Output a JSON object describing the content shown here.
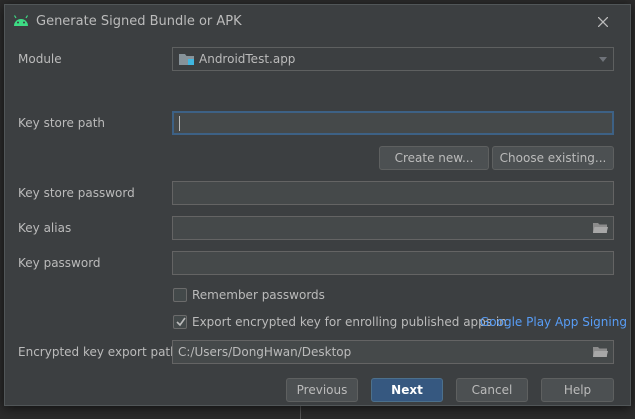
{
  "dialog": {
    "title": "Generate Signed Bundle or APK",
    "title_icon": "android-icon",
    "close_icon": "close-icon"
  },
  "module": {
    "label": "Module",
    "value": "AndroidTest.app"
  },
  "key_store": {
    "path_label": "Key store path",
    "path_value": "",
    "create_new_label": "Create new...",
    "choose_existing_label": "Choose existing...",
    "password_label": "Key store password",
    "password_value": ""
  },
  "key": {
    "alias_label": "Key alias",
    "alias_value": "",
    "password_label": "Key password",
    "password_value": ""
  },
  "options": {
    "remember_passwords_label": "Remember passwords",
    "remember_passwords_checked": false,
    "export_encrypted_label": "Export encrypted key for enrolling published apps in",
    "export_encrypted_checked": true,
    "play_signing_link": "Google Play App Signing"
  },
  "export_path": {
    "label": "Encrypted key export path",
    "value": "C:/Users/DongHwan/Desktop"
  },
  "buttons": {
    "previous": "Previous",
    "next": "Next",
    "cancel": "Cancel",
    "help": "Help"
  },
  "colors": {
    "dialog_bg": "#3c3f41",
    "field_bg": "#45494a",
    "focus_border": "#3d6185",
    "default_button": "#365880",
    "link": "#589df6",
    "android_green": "#3ddc84"
  }
}
